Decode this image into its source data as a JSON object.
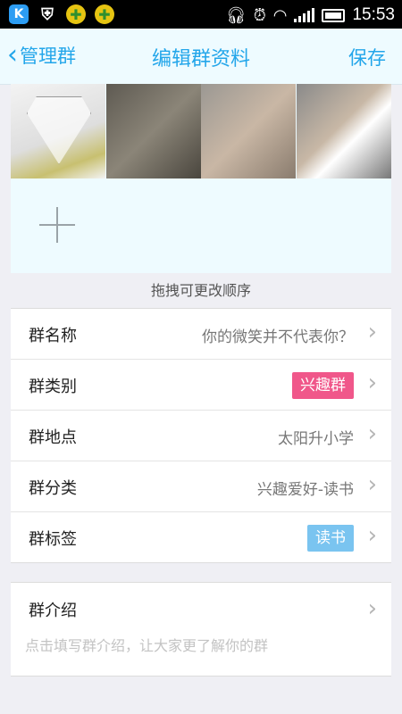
{
  "status_bar": {
    "time": "15:53",
    "icons": [
      "k-app-icon",
      "shield-icon",
      "plus-app-icon",
      "plus-app-icon",
      "headphones-icon",
      "alarm-icon",
      "wifi-icon",
      "signal-icon",
      "battery-icon"
    ]
  },
  "nav": {
    "back_label": "管理群",
    "title": "编辑群资料",
    "save_label": "保存"
  },
  "photos": {
    "hint": "拖拽可更改顺序"
  },
  "info_rows": [
    {
      "label": "群名称",
      "value": "你的微笑并不代表你？",
      "type": "text"
    },
    {
      "label": "群类别",
      "value": "兴趣群",
      "type": "tag",
      "tag_color": "#f0578a"
    },
    {
      "label": "群地点",
      "value": "太阳升小学",
      "type": "text"
    },
    {
      "label": "群分类",
      "value": "兴趣爱好-读书",
      "type": "text"
    },
    {
      "label": "群标签",
      "value": "读书",
      "type": "tag",
      "tag_color": "#7ac4f0"
    }
  ],
  "intro": {
    "label": "群介绍",
    "placeholder": "点击填写群介绍，让大家更了解你的群"
  },
  "colors": {
    "accent": "#23a6ea",
    "header_bg": "#eefbff",
    "page_bg": "#efeff4"
  }
}
